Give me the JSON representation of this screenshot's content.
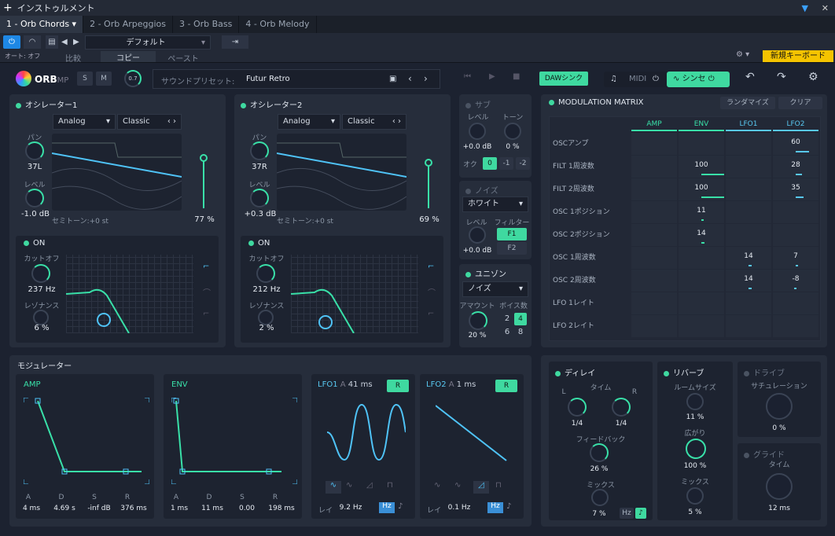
{
  "window": {
    "title": "インストゥルメント"
  },
  "tabs": [
    "1 - Orb Chords",
    "2 - Orb Arpeggios",
    "3 - Orb Bass",
    "4 - Orb Melody"
  ],
  "toolbar": {
    "auto": "オート: オフ",
    "compare": "比較",
    "copy": "コピー",
    "paste": "ペースト",
    "preset": "デフォルト",
    "keyboard": "新規キーボード"
  },
  "synth": {
    "logo": "ORB",
    "logo_sub": "MP",
    "s": "S",
    "m": "M",
    "vol": "0.7",
    "preset_label": "サウンドプリセット:",
    "preset_name": "Futur Retro",
    "daw_sync": "DAWシンク",
    "midi": "MIDI",
    "synth_btn": "シンセ"
  },
  "osc1": {
    "title": "オシレーター1",
    "wave": "Analog",
    "mode": "Classic",
    "pan_label": "パン",
    "pan": "37L",
    "level_label": "レベル",
    "level": "-1.0 dB",
    "semi": "セミトーン:+0 st",
    "vol": "77 %",
    "filter_on": "ON",
    "cutoff_label": "カットオフ",
    "cutoff": "237 Hz",
    "res_label": "レゾナンス",
    "res": "6 %"
  },
  "osc2": {
    "title": "オシレーター2",
    "wave": "Analog",
    "mode": "Classic",
    "pan_label": "パン",
    "pan": "37R",
    "level_label": "レベル",
    "level": "+0.3 dB",
    "semi": "セミトーン:+0 st",
    "vol": "69 %",
    "filter_on": "ON",
    "cutoff_label": "カットオフ",
    "cutoff": "212 Hz",
    "res_label": "レゾナンス",
    "res": "2 %"
  },
  "sub": {
    "title": "サブ",
    "level_label": "レベル",
    "tone_label": "トーン",
    "level": "+0.0 dB",
    "tone": "0 %",
    "oct_label": "オク",
    "oct": [
      "0",
      "-1",
      "-2"
    ]
  },
  "noise": {
    "title": "ノイズ",
    "type": "ホワイト",
    "level_label": "レベル",
    "filter_label": "フィルター",
    "level": "+0.0 dB",
    "f1": "F1",
    "f2": "F2"
  },
  "unison": {
    "title": "ユニゾン",
    "type": "ノイズ",
    "amount_label": "アマウント",
    "voices_label": "ボイス数",
    "amount": "20 %",
    "voices": [
      "2",
      "4",
      "6",
      "8"
    ]
  },
  "matrix": {
    "title": "MODULATION MATRIX",
    "randomize": "ランダマイズ",
    "clear": "クリア",
    "cols": [
      "AMP",
      "ENV",
      "LFO1",
      "LFO2"
    ],
    "rows": [
      {
        "name": "OSCアンプ",
        "v": [
          "",
          "",
          "",
          "60"
        ]
      },
      {
        "name": "FILT 1周波数",
        "v": [
          "",
          "100",
          "",
          "28"
        ]
      },
      {
        "name": "FILT 2周波数",
        "v": [
          "",
          "100",
          "",
          "35"
        ]
      },
      {
        "name": "OSC 1ポジション",
        "v": [
          "",
          "11",
          "",
          ""
        ]
      },
      {
        "name": "OSC 2ポジション",
        "v": [
          "",
          "14",
          "",
          ""
        ]
      },
      {
        "name": "OSC 1周波数",
        "v": [
          "",
          "",
          "14",
          "7"
        ]
      },
      {
        "name": "OSC 2周波数",
        "v": [
          "",
          "",
          "14",
          "-8"
        ]
      },
      {
        "name": "LFO 1レイト",
        "v": [
          "",
          "",
          "",
          ""
        ]
      },
      {
        "name": "LFO 2レイト",
        "v": [
          "",
          "",
          "",
          ""
        ]
      }
    ]
  },
  "modulators": {
    "title": "モジュレーター",
    "amp": {
      "title": "AMP",
      "labels": [
        "A",
        "D",
        "S",
        "R"
      ],
      "values": [
        "4 ms",
        "4.69 s",
        "-inf dB",
        "376 ms"
      ]
    },
    "env": {
      "title": "ENV",
      "labels": [
        "A",
        "D",
        "S",
        "R"
      ],
      "values": [
        "1 ms",
        "11 ms",
        "0.00",
        "198 ms"
      ]
    },
    "lfo1": {
      "title": "LFO1",
      "a": "A",
      "time": "41 ms",
      "r": "R",
      "rate_label": "レイ",
      "rate": "9.2 Hz",
      "hz": "Hz"
    },
    "lfo2": {
      "title": "LFO2",
      "a": "A",
      "time": "1 ms",
      "r": "R",
      "rate_label": "レイ",
      "rate": "0.1 Hz",
      "hz": "Hz"
    }
  },
  "delay": {
    "title": "ディレイ",
    "time_label": "タイム",
    "l": "L",
    "r": "R",
    "tl": "1/4",
    "tr": "1/4",
    "fb_label": "フィードバック",
    "fb": "26 %",
    "mix_label": "ミックス",
    "mix": "7 %",
    "hz": "Hz"
  },
  "reverb": {
    "title": "リバーブ",
    "room_label": "ルームサイズ",
    "room": "11 %",
    "width_label": "広がり",
    "width": "100 %",
    "mix_label": "ミックス",
    "mix": "5 %"
  },
  "drive": {
    "title": "ドライブ",
    "sat_label": "サチュレーション",
    "sat": "0 %"
  },
  "glide": {
    "title": "グライド",
    "time_label": "タイム",
    "time": "12 ms"
  }
}
